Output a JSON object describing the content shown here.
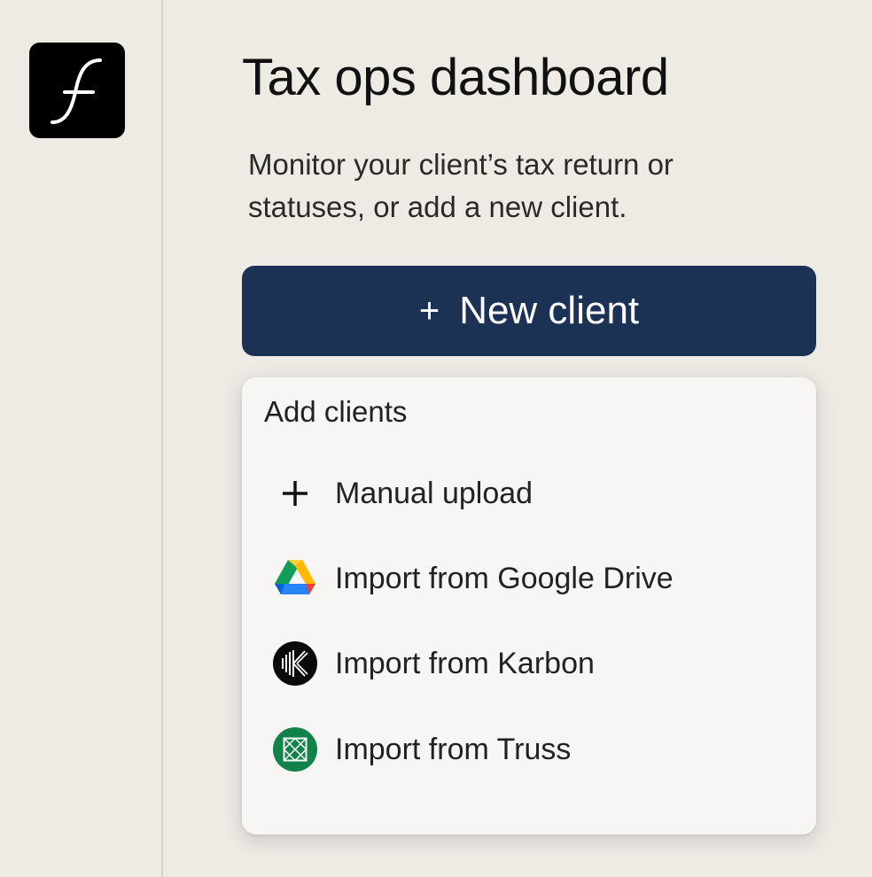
{
  "sidebar": {
    "logo_icon": "f-logo-icon"
  },
  "main": {
    "title": "Tax ops dashboard",
    "subtitle": "Monitor your client’s tax return or statuses, or add a new client."
  },
  "new_client_button": {
    "icon": "plus-icon",
    "plus": "+",
    "label": "New client",
    "color": "#1c3254"
  },
  "add_clients_menu": {
    "header": "Add clients",
    "items": [
      {
        "icon": "plus-icon",
        "label": "Manual upload"
      },
      {
        "icon": "google-drive-icon",
        "label": "Import from Google Drive"
      },
      {
        "icon": "karbon-icon",
        "label": "Import from Karbon"
      },
      {
        "icon": "truss-icon",
        "label": "Import from Truss",
        "color": "#12824a"
      }
    ]
  }
}
